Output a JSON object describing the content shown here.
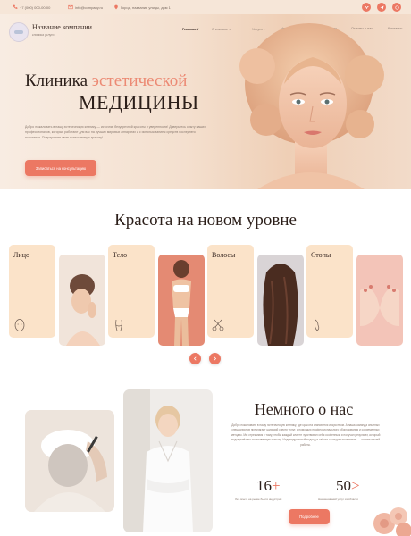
{
  "topbar": {
    "phone": "+7 (000) 000-00-00",
    "email": "info@company.ru",
    "address": "Город, название улицы, дом 1",
    "social_icons": [
      "vk-icon",
      "telegram-icon",
      "whatsapp-icon"
    ]
  },
  "header": {
    "company_name": "Название компании",
    "company_subtitle": "клиника услуги",
    "nav": [
      {
        "label": "Главная ▾",
        "active": true
      },
      {
        "label": "О клинике ▾",
        "active": false
      },
      {
        "label": "Услуги ▾",
        "active": false
      },
      {
        "label": "Наши специалисты",
        "active": false
      },
      {
        "label": "Акции",
        "active": false
      },
      {
        "label": "Отзывы о нас",
        "active": false
      },
      {
        "label": "Контакты",
        "active": false
      }
    ]
  },
  "hero": {
    "title_part1": "Клиника ",
    "title_accent": "эстетической",
    "title_line2": "МЕДИЦИНЫ",
    "description": "Добро пожаловать в нашу эстетическую клинику — источник безупречной красоты и уверенности! Доверьтесь опыту наших профессионалов, которые работают для вас на лучших мировых аппаратах и с использованием средств последнего поколения. Подчеркните свою естественную красоту!",
    "cta_label": "Записаться на консультацию"
  },
  "services": {
    "title": "Красота на новом уровне",
    "cards": [
      {
        "label": "Лицо",
        "icon": "face-icon"
      },
      {
        "label": "Тело",
        "icon": "body-icon"
      },
      {
        "label": "Волосы",
        "icon": "scissors-icon"
      },
      {
        "label": "Стопы",
        "icon": "foot-icon"
      }
    ],
    "prev_icon": "chevron-left-icon",
    "next_icon": "chevron-right-icon"
  },
  "about": {
    "title": "Немного о нас",
    "text": "Добро пожаловать в нашу эстетическую клинику, где красота становится искусством. А наша команда опытных специалистов предлагает широкий спектр услуг, с помощью профессионального оборудования и современных методик. Мы стремимся к тому, чтобы каждый клиент чувствовал себя особенным и получал результат, который подчеркнёт его естественную красоту. Индивидуальный подход и забота о каждом посетителе — основа нашей работы.",
    "stats": [
      {
        "number": "16",
        "suffix": "+",
        "caption": "Лет опыта на рынке бьюти индустрии"
      },
      {
        "number": "50",
        "suffix": ">",
        "caption": "Наименований услуг из области"
      }
    ],
    "button_label": "Подробнее"
  },
  "colors": {
    "accent": "#ec7863",
    "card_bg": "#fbe3c9",
    "hero_bg": "#f4e0cf",
    "heading": "#2c1f1a"
  }
}
